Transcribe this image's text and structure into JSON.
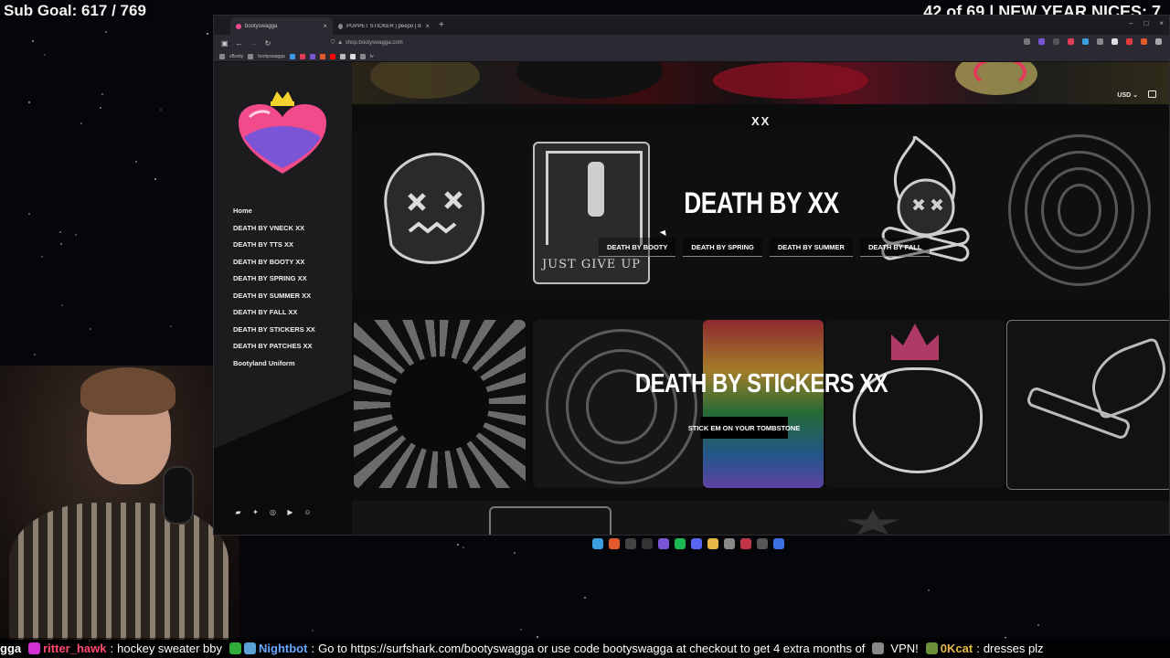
{
  "overlay": {
    "sub_goal": "Sub Goal: 617 / 769",
    "counter": "42 of 69 | NEW YEAR NICES: 7"
  },
  "browser": {
    "tabs": [
      {
        "label": "bootyswagga",
        "active": true
      },
      {
        "label": "PUPPET STICKER | peepo | booty...",
        "active": false
      }
    ],
    "url": "shop.bootyswagga.com",
    "bookmarks": [
      "xBooty",
      "bootyswagga",
      "",
      "",
      "",
      "",
      "",
      "",
      "",
      "tv"
    ]
  },
  "site": {
    "currency": "USD",
    "brand_mark": "XX",
    "menu": [
      "Home",
      "DEATH BY VNECK XX",
      "DEATH BY TTS XX",
      "DEATH BY BOOTY XX",
      "DEATH BY SPRING XX",
      "DEATH BY SUMMER XX",
      "DEATH BY FALL XX",
      "DEATH BY STICKERS XX",
      "DEATH BY PATCHES XX",
      "Bootyland Uniform"
    ],
    "socials": [
      "twitch-icon",
      "twitter-icon",
      "instagram-icon",
      "youtube-icon",
      "discord-icon"
    ],
    "hero1": {
      "title": "DEATH BY XX",
      "buttons": [
        "DEATH BY BOOTY",
        "DEATH BY SPRING",
        "DEATH BY SUMMER",
        "DEATH BY FALL"
      ],
      "art_caption": "JUST GIVE UP"
    },
    "hero2": {
      "title": "DEATH BY STICKERS XX",
      "cta": "STICK EM ON YOUR TOMBSTONE"
    }
  },
  "chat": {
    "messages": [
      {
        "user": "gga",
        "text": ""
      },
      {
        "user": "ritter_hawk",
        "text": "hockey sweater bby"
      },
      {
        "user": "Nightbot",
        "text": "Go to https://surfshark.com/bootyswagga or use code bootyswagga at checkout to get 4 extra months of"
      },
      {
        "user": "",
        "text": "VPN!"
      },
      {
        "user": "0Kcat",
        "text": "dresses plz"
      }
    ]
  },
  "colors": {
    "accent_pink": "#f24b8c",
    "crown_yellow": "#f5d22e",
    "purple": "#7a55d6",
    "nightbot": "#6aa7ff",
    "ritter": "#ff4b6e"
  }
}
